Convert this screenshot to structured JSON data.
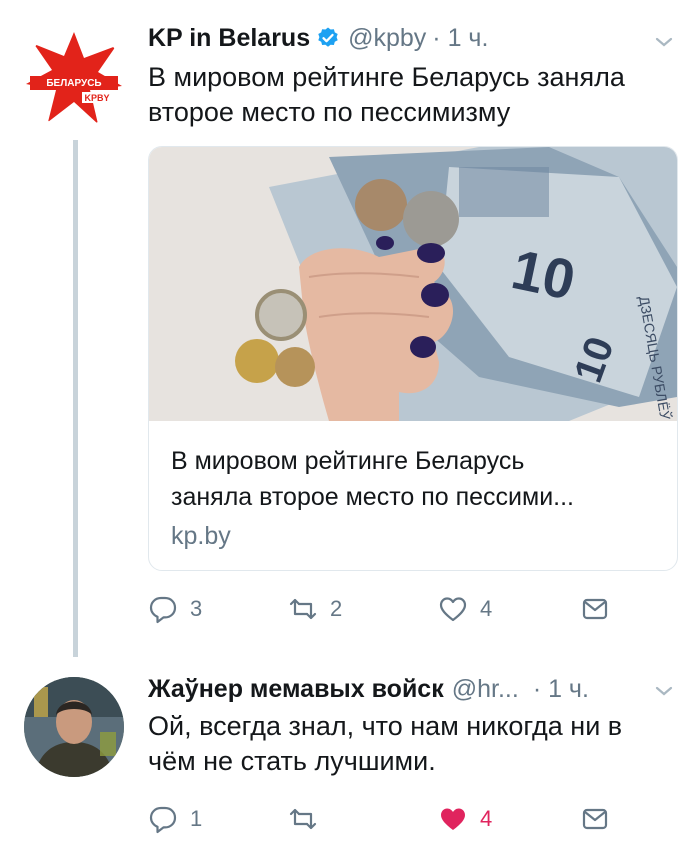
{
  "tweet1": {
    "author_name": "KP in Belarus",
    "handle": "@kpby",
    "time": "· 1 ч.",
    "text_line1": "В мировом рейтинге Беларусь заняла",
    "text_line2": "второе место по пессимизму",
    "avatar_logo": "БЕЛАРУСЬ KPBY",
    "card": {
      "title_line1": "В мировом рейтинге Беларусь",
      "title_line2": "заняла второе место по пессими...",
      "domain": "kp.by"
    },
    "actions": {
      "replies": "3",
      "retweets": "2",
      "likes": "4"
    }
  },
  "tweet2": {
    "author_name": "Жаўнер мемавых войск",
    "handle": "@hr...",
    "time": "· 1 ч.",
    "text_line1": "Ой, всегда знал, что нам никогда ни в",
    "text_line2": "чём не стать лучшими.",
    "actions": {
      "replies": "1",
      "retweets": "",
      "likes": "4"
    }
  },
  "colors": {
    "verified": "#1da1f2",
    "liked": "#e0245e",
    "muted": "#657786"
  },
  "icons": [
    "verified-badge-icon",
    "chevron-down-icon",
    "reply-icon",
    "retweet-icon",
    "like-icon",
    "dm-icon"
  ]
}
